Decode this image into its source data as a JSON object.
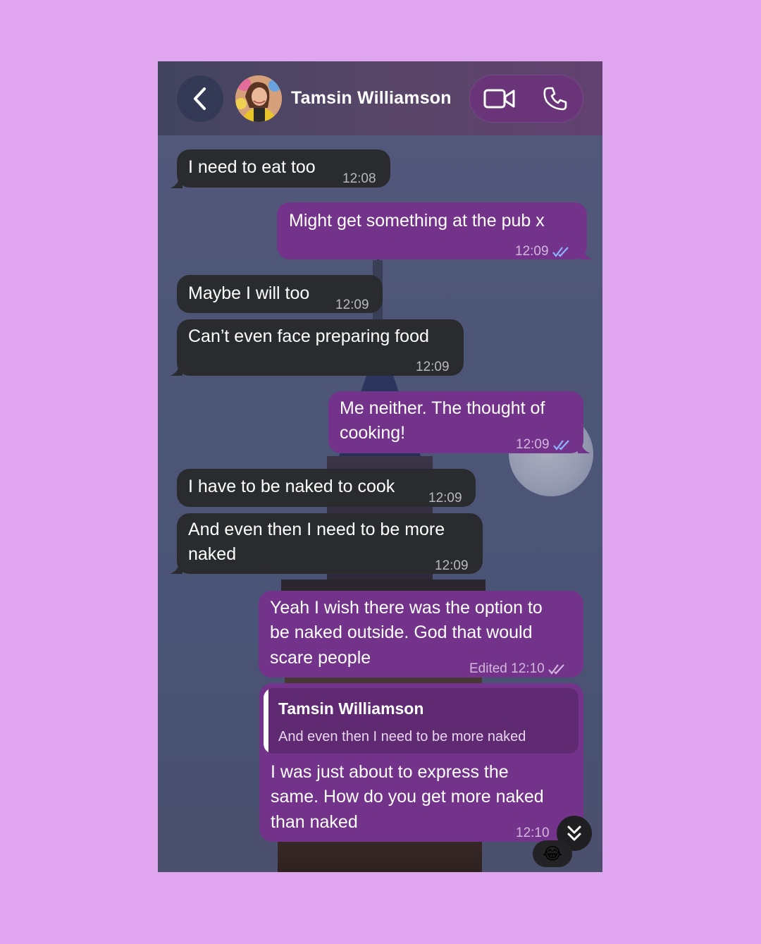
{
  "header": {
    "contact_name": "Tamsin Williamson",
    "back_icon": "chevron-left-icon",
    "video_icon": "video-camera-icon",
    "call_icon": "phone-icon"
  },
  "messages": [
    {
      "direction": "in",
      "text": "I need to eat too",
      "time": "12:08"
    },
    {
      "direction": "out",
      "text": "Might get something at the pub x",
      "time": "12:09",
      "status": "read"
    },
    {
      "direction": "in",
      "text": "Maybe I will too",
      "time": "12:09"
    },
    {
      "direction": "in",
      "text": "Can’t even face preparing food",
      "time": "12:09"
    },
    {
      "direction": "out",
      "text_line1": "Me neither. The thought of",
      "text_line2": "cooking!",
      "time": "12:09",
      "status": "read"
    },
    {
      "direction": "in",
      "text": "I have to be naked to cook",
      "time": "12:09"
    },
    {
      "direction": "in",
      "text_line1": "And even then I need to be more",
      "text_line2": "naked",
      "time": "12:09"
    },
    {
      "direction": "out",
      "text_line1": "Yeah I wish there was the option to",
      "text_line2": "be naked outside. God that would",
      "text_line3": "scare people",
      "edited_label": "Edited",
      "time": "12:10",
      "status": "sent"
    },
    {
      "direction": "out",
      "reply_to_name": "Tamsin Williamson",
      "reply_to_text": "And even then I need to be more naked",
      "text_line1": "I was just about to express the",
      "text_line2": "same. How do you get more naked",
      "text_line3": "than naked",
      "time": "12:10",
      "reaction": "😂"
    }
  ],
  "colors": {
    "page_background": "#dfa6ef",
    "incoming_bubble": "#2a2b2e",
    "outgoing_bubble": "#73338a",
    "read_tick": "#8fb4ff"
  }
}
